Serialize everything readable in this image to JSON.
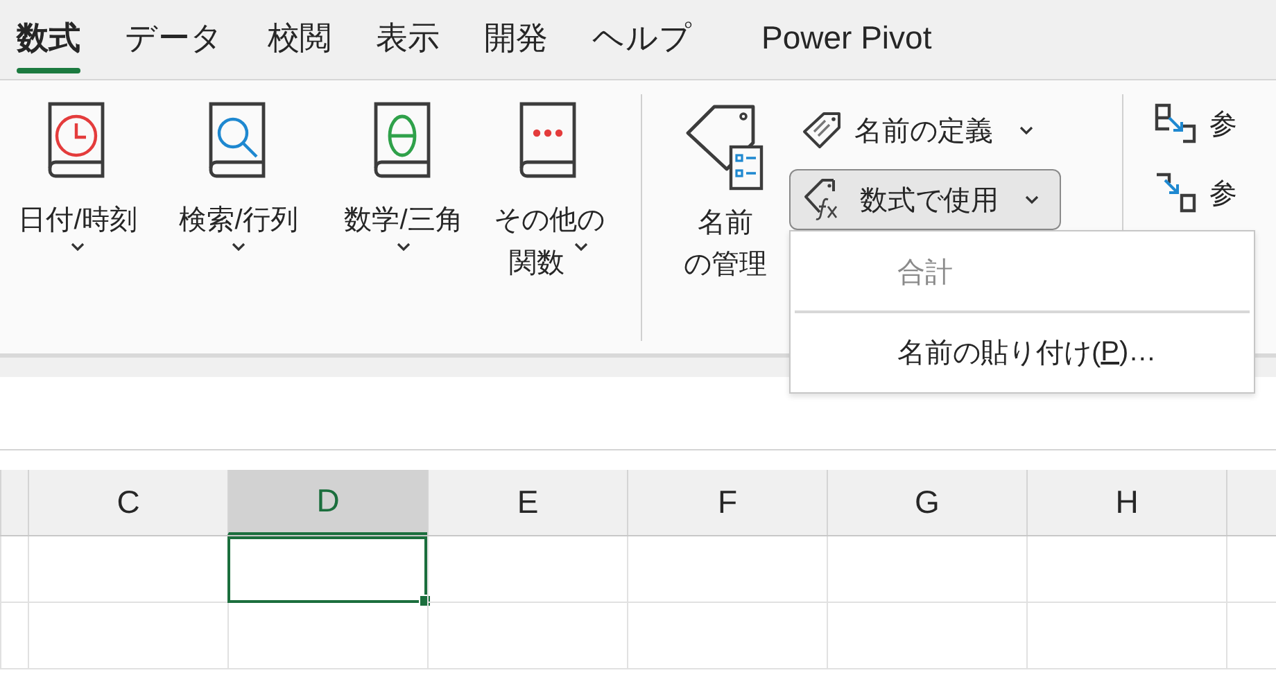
{
  "tabs": [
    {
      "label": "数式",
      "selected": true
    },
    {
      "label": "データ",
      "selected": false
    },
    {
      "label": "校閲",
      "selected": false
    },
    {
      "label": "表示",
      "selected": false
    },
    {
      "label": "開発",
      "selected": false
    },
    {
      "label": "ヘルプ",
      "selected": false
    },
    {
      "label": "Power Pivot",
      "selected": false
    }
  ],
  "ribbon": {
    "function_buttons": [
      {
        "kind": "clock",
        "lines": [
          "日付/時刻"
        ]
      },
      {
        "kind": "search",
        "lines": [
          "検索/行列"
        ]
      },
      {
        "kind": "theta",
        "lines": [
          "数学/三角"
        ]
      },
      {
        "kind": "dots",
        "lines": [
          "その他の",
          "関数"
        ]
      }
    ],
    "name_manager": {
      "lines": [
        "名前",
        "の管理"
      ]
    },
    "name_buttons": [
      {
        "kind": "tag",
        "label": "名前の定義",
        "pressed": false
      },
      {
        "kind": "fx",
        "label": "数式で使用",
        "pressed": true
      }
    ],
    "audit_buttons": [
      {
        "kind": "precedents",
        "label": "参"
      },
      {
        "kind": "dependents",
        "label": "参"
      }
    ]
  },
  "menu": {
    "items": [
      {
        "label": "合計",
        "disabled": true
      },
      {
        "label": "名前の貼り付け(",
        "access_key": "P",
        "after": ")…",
        "disabled": false
      }
    ]
  },
  "grid": {
    "columns": [
      {
        "label": "C",
        "selected": false
      },
      {
        "label": "D",
        "selected": true
      },
      {
        "label": "E",
        "selected": false
      },
      {
        "label": "F",
        "selected": false
      },
      {
        "label": "G",
        "selected": false
      },
      {
        "label": "H",
        "selected": false
      }
    ],
    "rows": [
      {
        "cells": [
          {
            "active": false
          },
          {
            "active": true
          },
          {
            "active": false
          },
          {
            "active": false
          },
          {
            "active": false
          },
          {
            "active": false
          }
        ]
      },
      {
        "cells": [
          {
            "active": false
          },
          {
            "active": false
          },
          {
            "active": false
          },
          {
            "active": false
          },
          {
            "active": false
          },
          {
            "active": false
          }
        ]
      }
    ]
  }
}
